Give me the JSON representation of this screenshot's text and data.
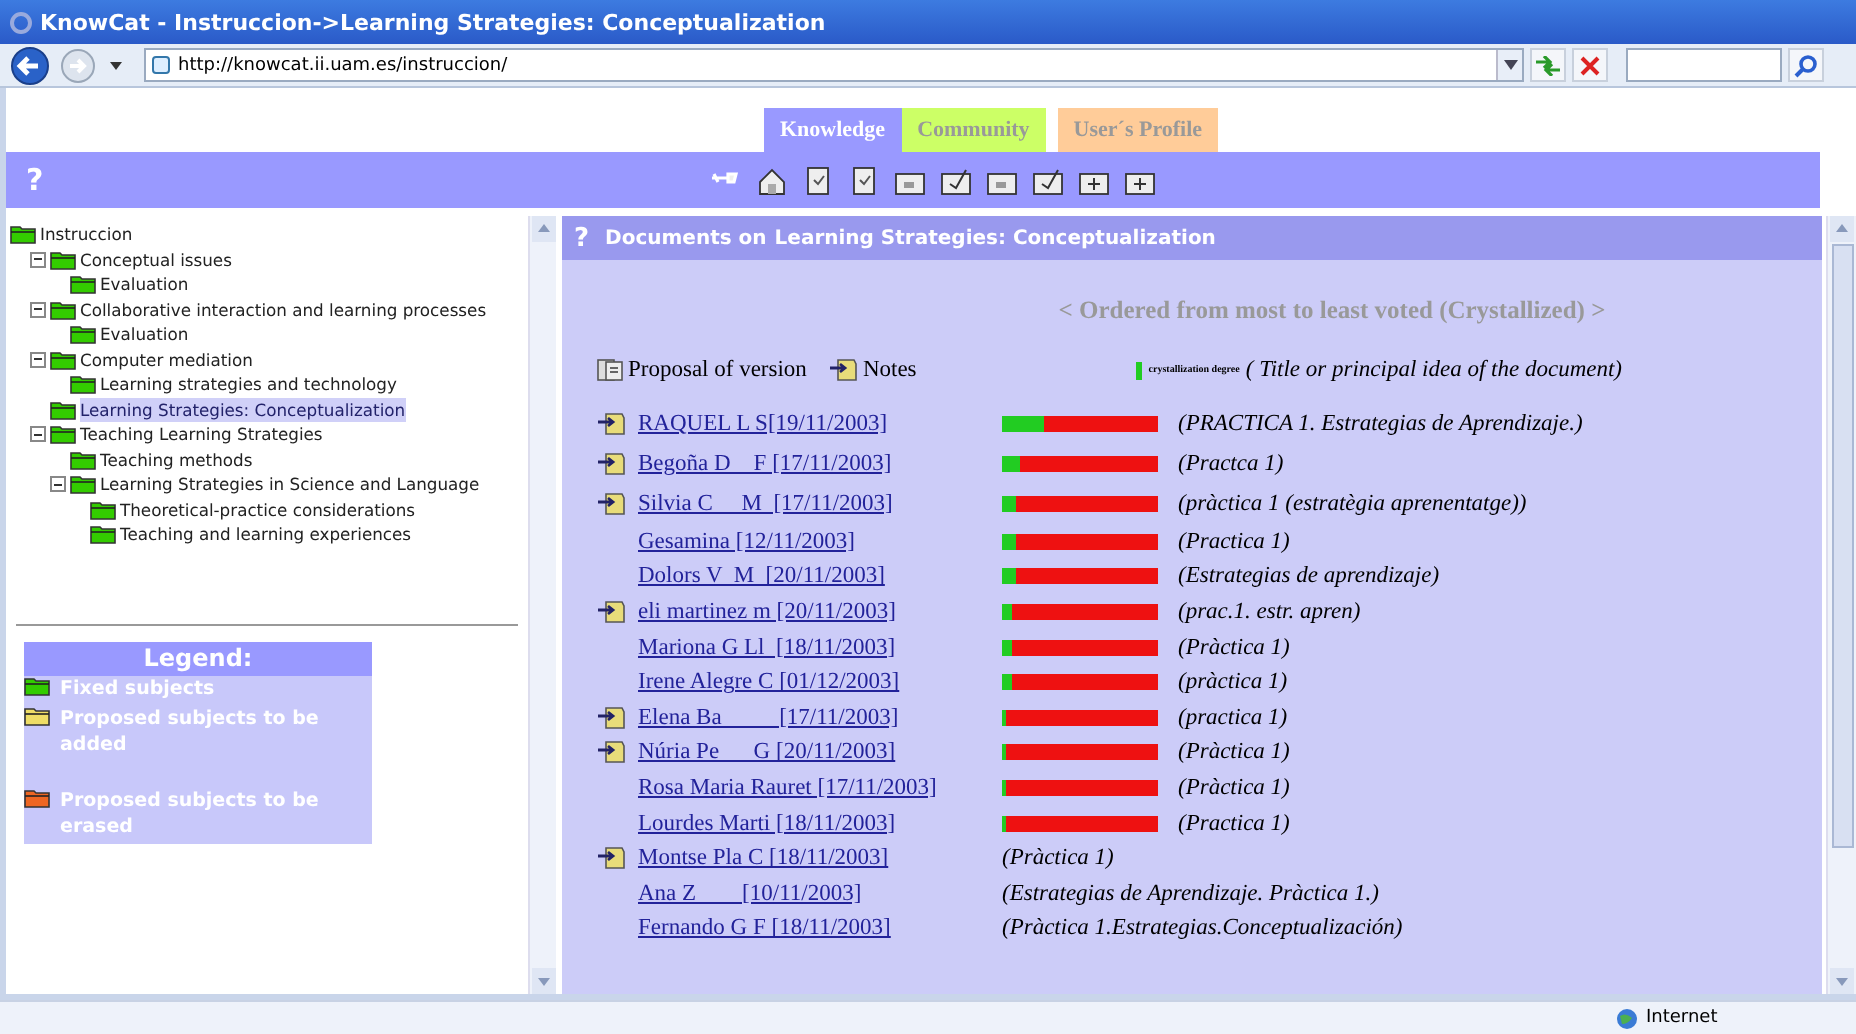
{
  "window": {
    "title": "KnowCat - Instruccion->Learning Strategies: Conceptualization"
  },
  "address_bar": {
    "url": "http://knowcat.ii.uam.es/instruccion/"
  },
  "tabs": [
    {
      "label": "Knowledge",
      "selected": true,
      "color": "#9999ff"
    },
    {
      "label": "Community",
      "selected": false,
      "color": "#ccff66"
    },
    {
      "label": "User´s Profile",
      "selected": false,
      "color": "#ffcc99"
    }
  ],
  "toolbar": {
    "help": "?"
  },
  "tree": [
    {
      "label": "Instruccion",
      "selected": false,
      "children": [
        {
          "label": "Conceptual issues",
          "selected": false,
          "expanded": true,
          "children": [
            {
              "label": "Evaluation",
              "selected": false
            }
          ]
        },
        {
          "label": "Collaborative interaction and learning processes",
          "selected": false,
          "expanded": true,
          "children": [
            {
              "label": "Evaluation",
              "selected": false
            }
          ]
        },
        {
          "label": "Computer mediation",
          "selected": false,
          "expanded": true,
          "children": [
            {
              "label": "Learning strategies and technology",
              "selected": false
            }
          ]
        },
        {
          "label": "Learning Strategies: Conceptualization",
          "selected": true
        },
        {
          "label": "Teaching Learning Strategies",
          "selected": false,
          "expanded": true,
          "children": [
            {
              "label": "Teaching methods",
              "selected": false
            },
            {
              "label": "Learning Strategies in Science and Language",
              "selected": false,
              "expanded": true,
              "children": [
                {
                  "label": "Theoretical-practice considerations",
                  "selected": false
                },
                {
                  "label": "Teaching and learning experiences",
                  "selected": false
                }
              ]
            }
          ]
        }
      ]
    }
  ],
  "legend": {
    "title": "Legend:",
    "items": [
      {
        "label": "Fixed subjects",
        "color": "#33cc00"
      },
      {
        "label": "Proposed subjects to be added",
        "color": "#eedd66"
      },
      {
        "label": "Proposed subjects to be erased",
        "color": "#ee6622"
      }
    ]
  },
  "documents": {
    "help": "?",
    "heading": "Documents on",
    "topic": "Learning Strategies: Conceptualization",
    "order_note": "< Ordered from most to least voted (Crystallized) >",
    "key": {
      "proposal": "Proposal of version",
      "notes": "Notes",
      "degree": "crystallization degree",
      "title": "( Title or principal idea of the document)"
    },
    "rows": [
      {
        "author": "RAQUEL L S[19/11/2003]",
        "notes": true,
        "level": 0.27,
        "title": "(PRACTICA 1. Estrategias de Aprendizaje.)"
      },
      {
        "author": "Begoña D    F [17/11/2003]",
        "notes": true,
        "level": 0.12,
        "title": "(Practca 1)"
      },
      {
        "author": "Silvia C     M  [17/11/2003]",
        "notes": true,
        "level": 0.09,
        "title": "(pràctica 1 (estratègia aprenentatge))"
      },
      {
        "author": "Gesamina [12/11/2003]",
        "notes": false,
        "level": 0.09,
        "title": "(Practica 1)"
      },
      {
        "author": "Dolors V  M  [20/11/2003]",
        "notes": false,
        "level": 0.09,
        "title": "(Estrategias de aprendizaje)"
      },
      {
        "author": "eli martinez m [20/11/2003]",
        "notes": true,
        "level": 0.06,
        "title": "(prac.1. estr. apren)"
      },
      {
        "author": "Mariona G Ll  [18/11/2003]",
        "notes": false,
        "level": 0.06,
        "title": "(Pràctica 1)"
      },
      {
        "author": "Irene Alegre C [01/12/2003]",
        "notes": false,
        "level": 0.06,
        "title": "(pràctica 1)"
      },
      {
        "author": "Elena Ba          [17/11/2003]",
        "notes": true,
        "level": 0.03,
        "title": "(practica 1)"
      },
      {
        "author": "Núria Pe      G [20/11/2003]",
        "notes": true,
        "level": 0.03,
        "title": "(Pràctica 1)"
      },
      {
        "author": "Rosa Maria Rauret [17/11/2003]",
        "notes": false,
        "level": 0.03,
        "title": "(Pràctica 1)"
      },
      {
        "author": "Lourdes Marti [18/11/2003]",
        "notes": false,
        "level": 0.03,
        "title": "(Practica 1)"
      },
      {
        "author": "Montse Pla C [18/11/2003]",
        "notes": true,
        "title": "(Pràctica 1)"
      },
      {
        "author": "Ana Z        [10/11/2003]",
        "notes": false,
        "title": "(Estrategias de Aprendizaje. Pràctica 1.)"
      },
      {
        "author": "Fernando G F [18/11/2003]",
        "notes": false,
        "title": "(Pràctica 1.Estrategias.Conceptualización)"
      }
    ]
  },
  "status_bar": {
    "zone": "Internet"
  }
}
